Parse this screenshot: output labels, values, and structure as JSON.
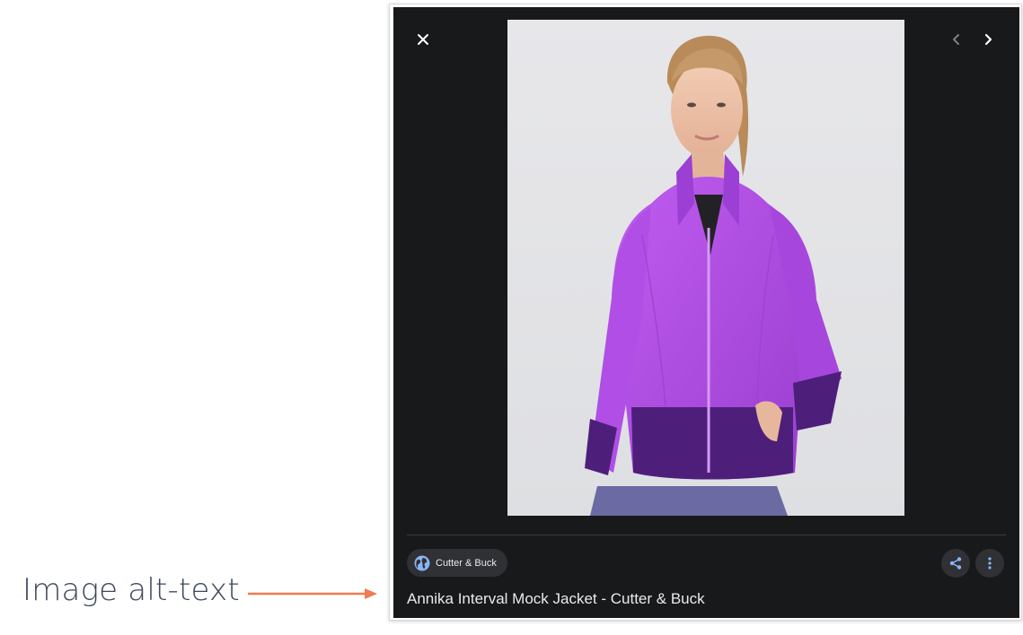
{
  "annotation": {
    "label": "Image alt-text",
    "arrow_color": "#f07a52"
  },
  "viewer": {
    "controls": {
      "close_icon": "close-icon",
      "prev_icon": "chevron-left-icon",
      "next_icon": "chevron-right-icon"
    },
    "image": {
      "subject": "woman wearing purple zip-up mock jacket",
      "accent_color": "#b44fe3",
      "panel_color": "#4d1f7a"
    },
    "source_chip": {
      "icon": "globe-icon",
      "label": "Cutter & Buck"
    },
    "actions": {
      "share_icon": "share-icon",
      "more_icon": "more-vert-icon"
    },
    "caption": "Annika Interval Mock Jacket - Cutter & Buck"
  }
}
